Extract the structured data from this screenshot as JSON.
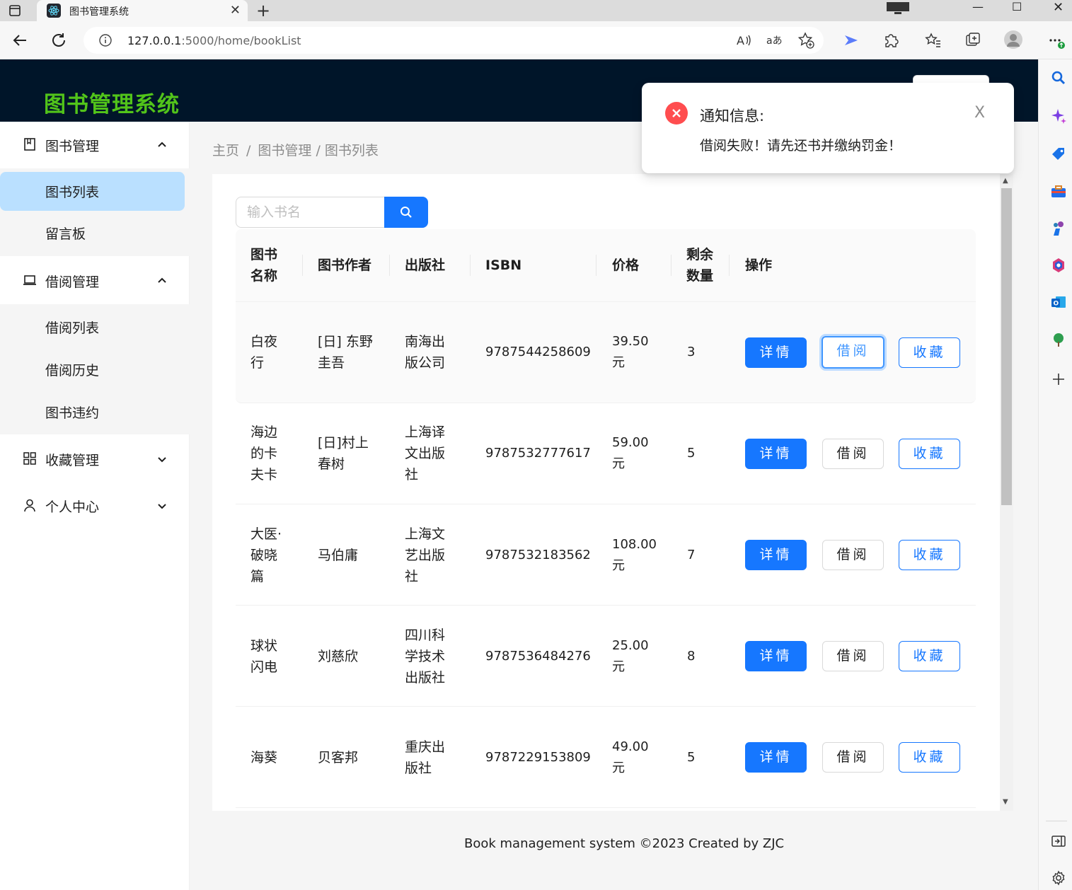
{
  "browser": {
    "tab_title": "图书管理系统",
    "tab_close": "✕",
    "new_tab": "+",
    "minimize": "—",
    "maximize": "☐",
    "close": "✕",
    "url_host": "127.0.0.1",
    "url_rest": ":5000/home/bookList"
  },
  "app": {
    "logo": "图书管理系统"
  },
  "sidebar": {
    "groups": [
      {
        "label": "图书管理",
        "icon": "book-icon",
        "expanded": true,
        "items": [
          {
            "label": "图书列表",
            "active": true
          },
          {
            "label": "留言板"
          }
        ]
      },
      {
        "label": "借阅管理",
        "icon": "laptop-icon",
        "expanded": true,
        "items": [
          {
            "label": "借阅列表"
          },
          {
            "label": "借阅历史"
          },
          {
            "label": "图书违约"
          }
        ]
      },
      {
        "label": "收藏管理",
        "icon": "appstore-icon",
        "expanded": false
      },
      {
        "label": "个人中心",
        "icon": "user-icon",
        "expanded": false
      }
    ]
  },
  "breadcrumb": {
    "home": "主页",
    "sep": "/",
    "section": "图书管理",
    "page": "/ 图书列表"
  },
  "search": {
    "placeholder": "输入书名"
  },
  "table": {
    "headers": {
      "name_1": "图书",
      "name_2": "名称",
      "author": "图书作者",
      "publisher": "出版社",
      "isbn": "ISBN",
      "price": "价格",
      "remain_1": "剩余",
      "remain_2": "数量",
      "actions": "操作"
    },
    "actions": {
      "detail": "详情",
      "borrow": "借阅",
      "favorite": "收藏"
    },
    "rows": [
      {
        "name": [
          "白夜",
          "行"
        ],
        "author": [
          "[日] 东野",
          "圭吾"
        ],
        "publisher": [
          "南海出",
          "版公司"
        ],
        "isbn": "9787544258609",
        "price": [
          "39.50",
          "元"
        ],
        "remain": "3"
      },
      {
        "name": [
          "海边",
          "的卡",
          "夫卡"
        ],
        "author": [
          "[日]村上",
          "春树"
        ],
        "publisher": [
          "上海译",
          "文出版",
          "社"
        ],
        "isbn": "9787532777617",
        "price": [
          "59.00",
          "元"
        ],
        "remain": "5"
      },
      {
        "name": [
          "大医·",
          "破晓",
          "篇"
        ],
        "author": [
          "马伯庸"
        ],
        "publisher": [
          "上海文",
          "艺出版",
          "社"
        ],
        "isbn": "9787532183562",
        "price": [
          "108.00",
          "元"
        ],
        "remain": "7"
      },
      {
        "name": [
          "球状",
          "闪电"
        ],
        "author": [
          "刘慈欣"
        ],
        "publisher": [
          "四川科",
          "学技术",
          "出版社"
        ],
        "isbn": "9787536484276",
        "price": [
          "25.00",
          "元"
        ],
        "remain": "8"
      },
      {
        "name": [
          "海葵"
        ],
        "author": [
          "贝客邦"
        ],
        "publisher": [
          "重庆出",
          "版社"
        ],
        "isbn": "9787229153809",
        "price": [
          "49.00",
          "元"
        ],
        "remain": "5"
      }
    ]
  },
  "notification": {
    "title": "通知信息:",
    "message": "借阅失败！请先还书并缴纳罚金！",
    "close": "X"
  },
  "footer": {
    "text": "Book management system ©2023 Created by ZJC"
  },
  "colors": {
    "primary": "#1677ff",
    "header": "#001529",
    "logo": "#52c41a",
    "error": "#ff4d4f",
    "active_menu": "#bae0ff"
  }
}
